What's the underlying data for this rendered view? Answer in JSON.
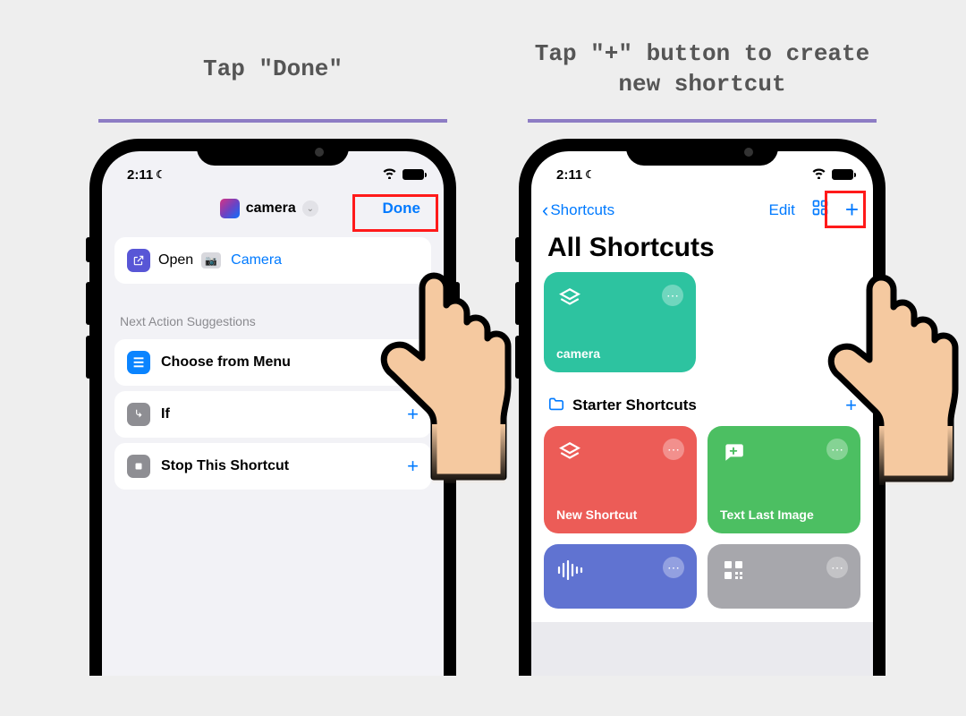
{
  "left": {
    "caption": "Tap \"Done\"",
    "status_time": "2:11",
    "shortcut_name": "camera",
    "done_label": "Done",
    "action": {
      "open_label": "Open",
      "target_name": "Camera"
    },
    "suggestions_header": "Next Action Suggestions",
    "suggestions": [
      {
        "label": "Choose from Menu",
        "icon": "menu"
      },
      {
        "label": "If",
        "icon": "if"
      },
      {
        "label": "Stop This Shortcut",
        "icon": "stop"
      }
    ]
  },
  "right": {
    "caption": "Tap \"+\" button to create new shortcut",
    "status_time": "2:11",
    "back_label": "Shortcuts",
    "edit_label": "Edit",
    "page_title": "All Shortcuts",
    "camera_tile": "camera",
    "section_label": "Starter Shortcuts",
    "tiles": {
      "red": "New Shortcut",
      "green": "Text Last Image"
    }
  }
}
